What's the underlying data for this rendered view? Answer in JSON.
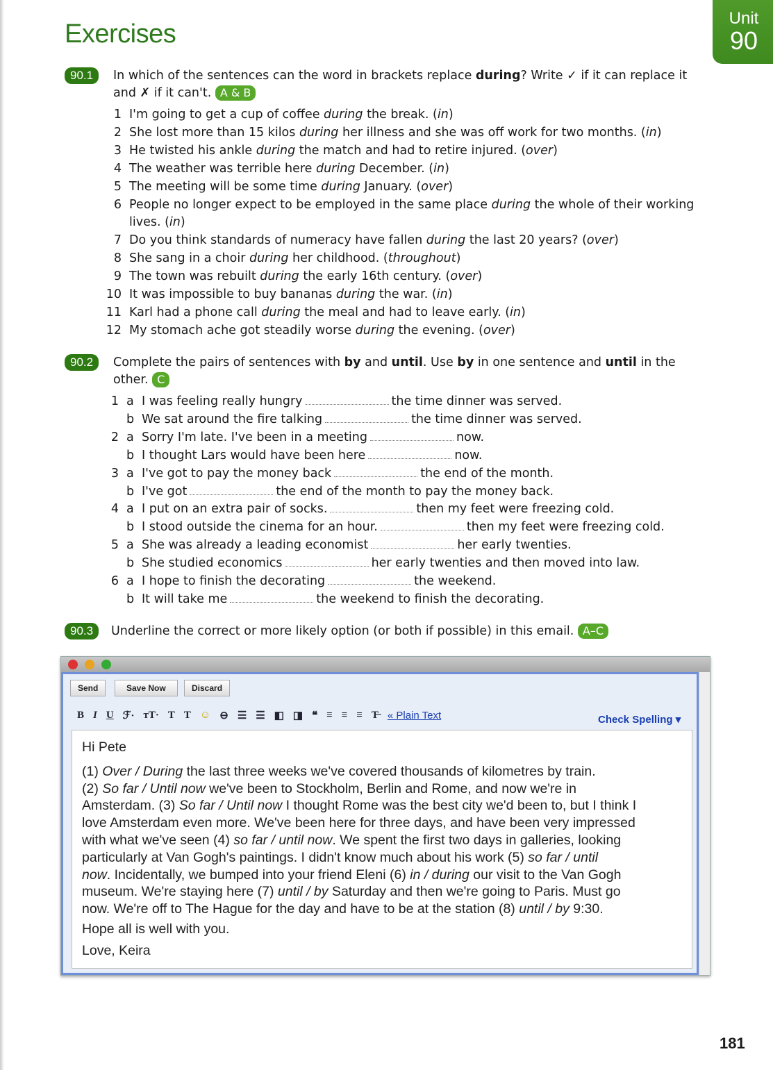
{
  "title": "Exercises",
  "unit": {
    "label": "Unit",
    "number": "90"
  },
  "ex1": {
    "num": "90.1",
    "pre": "In which of the sentences can the word in brackets replace ",
    "bold": "during",
    "post": "? Write ✓ if it can replace it and ✗ if it can't. ",
    "tag": "A & B",
    "items": [
      {
        "n": "1",
        "a": "I'm going to get a cup of coffee ",
        "w": "during",
        "b": " the break. (",
        "p": "in",
        "c": ")"
      },
      {
        "n": "2",
        "a": "She lost more than 15 kilos ",
        "w": "during",
        "b": " her illness and she was off work for two months. (",
        "p": "in",
        "c": ")"
      },
      {
        "n": "3",
        "a": "He twisted his ankle ",
        "w": "during",
        "b": " the match and had to retire injured. (",
        "p": "over",
        "c": ")"
      },
      {
        "n": "4",
        "a": "The weather was terrible here ",
        "w": "during",
        "b": " December. (",
        "p": "in",
        "c": ")"
      },
      {
        "n": "5",
        "a": "The meeting will be some time ",
        "w": "during",
        "b": " January. (",
        "p": "over",
        "c": ")"
      },
      {
        "n": "6",
        "a": "People no longer expect to be employed in the same place ",
        "w": "during",
        "b": " the whole of their working lives. (",
        "p": "in",
        "c": ")"
      },
      {
        "n": "7",
        "a": "Do you think standards of numeracy have fallen ",
        "w": "during",
        "b": " the last 20 years? (",
        "p": "over",
        "c": ")"
      },
      {
        "n": "8",
        "a": "She sang in a choir ",
        "w": "during",
        "b": " her childhood. (",
        "p": "throughout",
        "c": ")"
      },
      {
        "n": "9",
        "a": "The town was rebuilt ",
        "w": "during",
        "b": " the early 16th century. (",
        "p": "over",
        "c": ")"
      },
      {
        "n": "10",
        "a": "It was impossible to buy bananas ",
        "w": "during",
        "b": " the war. (",
        "p": "in",
        "c": ")"
      },
      {
        "n": "11",
        "a": "Karl had a phone call ",
        "w": "during",
        "b": " the meal and had to leave early. (",
        "p": "in",
        "c": ")"
      },
      {
        "n": "12",
        "a": "My stomach ache got steadily worse ",
        "w": "during",
        "b": " the evening. (",
        "p": "over",
        "c": ")"
      }
    ]
  },
  "ex2": {
    "num": "90.2",
    "h1": "Complete the pairs of sentences with ",
    "b1": "by",
    "h2": " and ",
    "b2": "until",
    "h3": ". Use ",
    "b3": "by",
    "h4": " in one sentence and ",
    "b4": "until",
    "h5": " in the other. ",
    "tag": "C",
    "items": [
      {
        "n": "1",
        "l": "a",
        "a": "I was feeling really hungry",
        "b": "the time dinner was served."
      },
      {
        "n": "",
        "l": "b",
        "a": "We sat around the fire talking",
        "b": "the time dinner was served."
      },
      {
        "n": "2",
        "l": "a",
        "a": "Sorry I'm late. I've been in a meeting",
        "b": "now."
      },
      {
        "n": "",
        "l": "b",
        "a": "I thought Lars would have been here",
        "b": "now."
      },
      {
        "n": "3",
        "l": "a",
        "a": "I've got to pay the money back",
        "b": "the end of the month."
      },
      {
        "n": "",
        "l": "b",
        "a": "I've got",
        "b": "the end of the month to pay the money back."
      },
      {
        "n": "4",
        "l": "a",
        "a": "I put on an extra pair of socks.",
        "b": "then my feet were freezing cold."
      },
      {
        "n": "",
        "l": "b",
        "a": "I stood outside the cinema for an hour.",
        "b": "then my feet were freezing cold."
      },
      {
        "n": "5",
        "l": "a",
        "a": "She was already a leading economist",
        "b": "her early twenties."
      },
      {
        "n": "",
        "l": "b",
        "a": "She studied economics",
        "b": "her early twenties and then moved into law."
      },
      {
        "n": "6",
        "l": "a",
        "a": "I hope to finish the decorating",
        "b": "the weekend."
      },
      {
        "n": "",
        "l": "b",
        "a": "It will take me",
        "b": "the weekend to finish the decorating."
      }
    ]
  },
  "ex3": {
    "num": "90.3",
    "text": "Underline the correct or more likely option (or both if possible) in this email. ",
    "tag": "A–C"
  },
  "email": {
    "buttons": [
      "Send",
      "Save Now",
      "Discard"
    ],
    "toolbar": [
      "B",
      "I",
      "U",
      "ℱ·",
      "тT·",
      "T",
      "T",
      "☺",
      "⊖",
      "☰",
      "☰",
      "◧",
      "◨",
      "❝",
      "≡",
      "≡",
      "≡",
      "T̶"
    ],
    "plain_text": "« Plain Text",
    "check_spelling": "Check Spelling ▾",
    "greeting": "Hi Pete",
    "lines": [
      [
        [
          "(1) ",
          0
        ],
        [
          "Over / During",
          1
        ],
        [
          " the last three weeks we've covered thousands of kilometres by train.",
          0
        ]
      ],
      [
        [
          "(2) ",
          0
        ],
        [
          "So far / Until now",
          1
        ],
        [
          " we've been to Stockholm, Berlin and Rome, and now we're in",
          0
        ]
      ],
      [
        [
          "Amsterdam. (3) ",
          0
        ],
        [
          "So far / Until now",
          1
        ],
        [
          " I thought Rome was the best city we'd been to, but I think I",
          0
        ]
      ],
      [
        [
          "love Amsterdam even more. We've been here for three days, and have been very impressed",
          0
        ]
      ],
      [
        [
          "with what we've seen (4) ",
          0
        ],
        [
          "so far / until now",
          1
        ],
        [
          ". We spent the first two days in galleries, looking",
          0
        ]
      ],
      [
        [
          "particularly at Van Gogh's paintings. I didn't know much about his work (5) ",
          0
        ],
        [
          "so far / until",
          1
        ]
      ],
      [
        [
          "now",
          1
        ],
        [
          ". Incidentally, we bumped into your friend Eleni (6) ",
          0
        ],
        [
          "in / during",
          1
        ],
        [
          " our visit to the Van Gogh",
          0
        ]
      ],
      [
        [
          "museum. We're staying here (7) ",
          0
        ],
        [
          "until / by",
          1
        ],
        [
          " Saturday and then we're going to Paris. Must go",
          0
        ]
      ],
      [
        [
          "now. We're off to The Hague for the day and have to be at the station (8) ",
          0
        ],
        [
          "until / by",
          1
        ],
        [
          " 9:30.",
          0
        ]
      ]
    ],
    "closing": "Hope all is well with you.",
    "signoff": "Love, Keira"
  },
  "page_number": "181",
  "colors": {
    "green_dark": "#2e7a12",
    "green_light": "#58a82a",
    "link": "#1a3fb0"
  }
}
